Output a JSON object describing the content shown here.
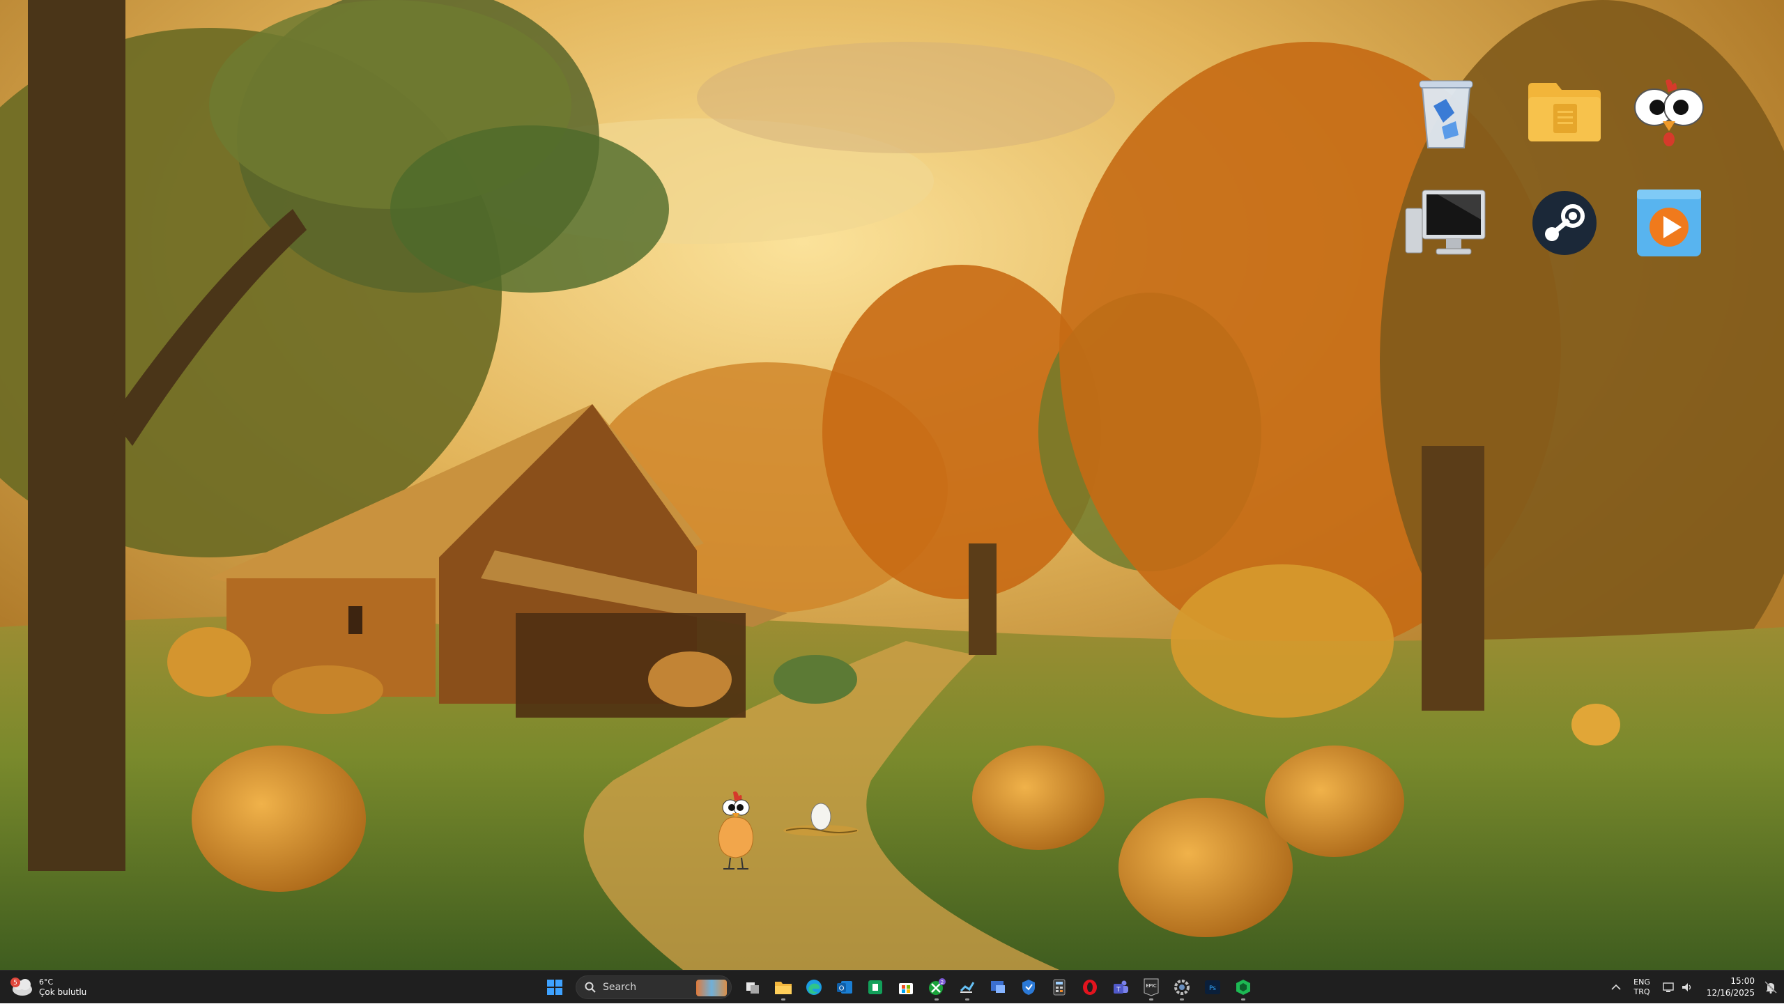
{
  "desktop": {
    "icons": [
      {
        "name": "recycle-bin",
        "icon": "recycle-bin-icon"
      },
      {
        "name": "folder",
        "icon": "folder-icon"
      },
      {
        "name": "chicken-app",
        "icon": "chicken-face-icon"
      },
      {
        "name": "this-pc",
        "icon": "monitor-icon"
      },
      {
        "name": "steam",
        "icon": "steam-icon"
      },
      {
        "name": "media-player",
        "icon": "media-player-icon"
      }
    ],
    "pet": {
      "icon": "chicken-pet-icon"
    },
    "egg": {
      "icon": "egg-nest-icon"
    }
  },
  "taskbar": {
    "weather": {
      "temp": "6°C",
      "condition": "Çok bulutlu",
      "badge": "5"
    },
    "search": {
      "label": "Search"
    },
    "apps": [
      "start-icon",
      "search-icon",
      "task-view-icon",
      "file-explorer-icon",
      "edge-icon",
      "outlook-icon",
      "excel-icon",
      "store-icon",
      "xbox-icon",
      "steam-taskbar-icon",
      "remote-desktop-icon",
      "defender-icon",
      "calculator-icon",
      "opera-icon",
      "teams-icon",
      "epic-games-icon",
      "settings-icon",
      "photoshop-icon",
      "cube-app-icon"
    ],
    "xbox_badge": "2",
    "epic_label": "EPIC",
    "ps_label": "Ps",
    "tray": {
      "lang_top": "ENG",
      "lang_bottom": "TRQ",
      "time": "15:00",
      "date": "12/16/2025"
    }
  },
  "colors": {
    "taskbar_bg": "#1f1f1f",
    "accent": "#0a84ff"
  }
}
